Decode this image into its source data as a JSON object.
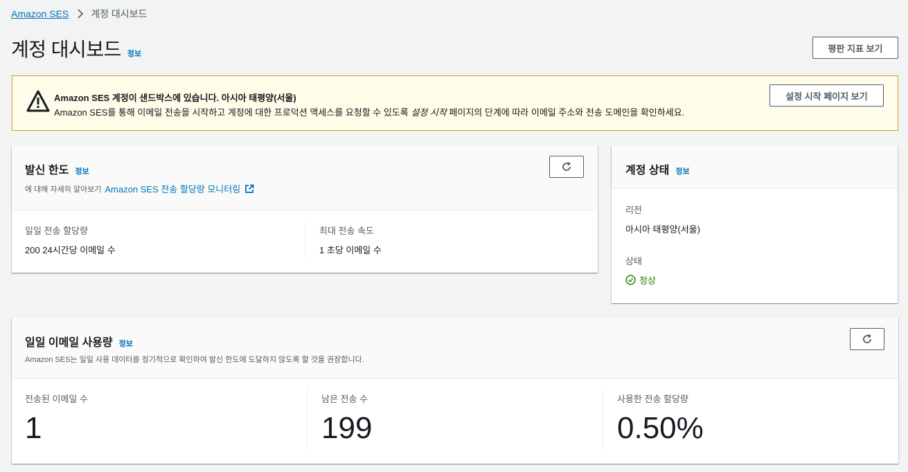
{
  "breadcrumb": {
    "root": "Amazon SES",
    "current": "계정 대시보드"
  },
  "page": {
    "title": "계정 대시보드",
    "info": "정보",
    "reputation_button": "평판 지표 보기"
  },
  "alert": {
    "title": "Amazon SES 계정이 샌드박스에 있습니다. 아시아 태평양(서울)",
    "body_before": "Amazon SES를 통해 이메일 전송을 시작하고 계정에 대한 프로덕션 액세스를 요청할 수 있도록 ",
    "body_emphasis": "설정 시작",
    "body_after": " 페이지의 단계에 따라 이메일 주소와 전송 도메인을 확인하세요.",
    "button": "설정 시작 페이지 보기"
  },
  "sending_limits": {
    "title": "발신 한도",
    "info": "정보",
    "sub_prefix": "에 대해 자세히 알아보기",
    "sub_link": "Amazon SES 전송 할당량 모니터링",
    "daily_quota_label": "일일 전송 할당량",
    "daily_quota_value": "200 24시간당 이메일 수",
    "max_rate_label": "최대 전송 속도",
    "max_rate_value": "1 초당 이메일 수"
  },
  "account_status": {
    "title": "계정 상태",
    "info": "정보",
    "region_label": "리전",
    "region_value": "아시아 태평양(서울)",
    "status_label": "상태",
    "status_value": "정상"
  },
  "daily_usage": {
    "title": "일일 이메일 사용량",
    "info": "정보",
    "sub": "Amazon SES는 일일 사용 데이터를 정기적으로 확인하여 발신 한도에 도달하지 않도록 할 것을 권장합니다.",
    "sent_label": "전송된 이메일 수",
    "sent_value": "1",
    "remaining_label": "남은 전송 수",
    "remaining_value": "199",
    "used_label": "사용한 전송 할당량",
    "used_value": "0.50%"
  },
  "colors": {
    "link": "#0073bb",
    "warning_border": "#d09c2a",
    "warning_bg": "#fffce9",
    "success": "#1d8102"
  }
}
